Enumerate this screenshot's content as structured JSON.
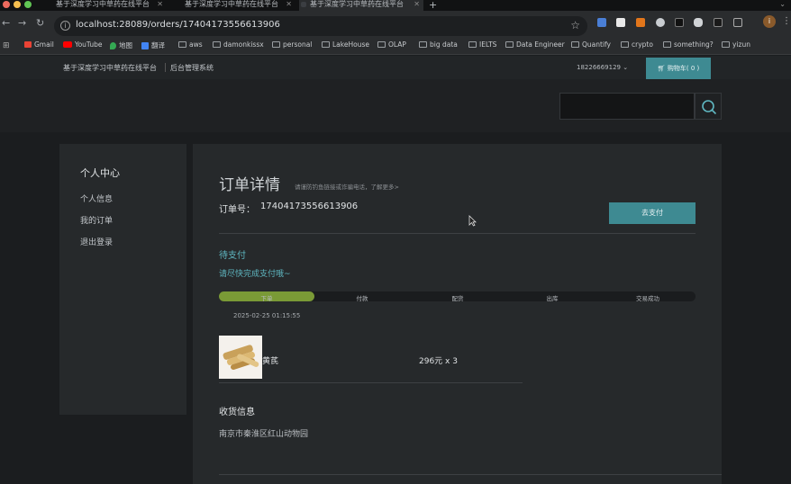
{
  "browser": {
    "tabs": [
      {
        "title": "基于深度学习中草药在线平台",
        "active": false
      },
      {
        "title": "基于深度学习中草药在线平台",
        "active": false
      },
      {
        "title": "基于深度学习中草药在线平台",
        "active": true
      }
    ],
    "url": "localhost:28089/orders/17404173556613906",
    "profile_initial": "i",
    "bookmarks": [
      "Gmail",
      "YouTube",
      "地图",
      "翻译",
      "aws",
      "damonkissx",
      "personal",
      "LakeHouse",
      "OLAP",
      "big data",
      "IELTS",
      "Data Engineer",
      "Quantify",
      "crypto",
      "something?",
      "yizun"
    ]
  },
  "header": {
    "site_title": "基于深度学习中草药在线平台",
    "admin_link": "后台管理系统",
    "user_phone": "18226669129",
    "cart_label": "购物车( 0 )"
  },
  "search": {
    "placeholder": ""
  },
  "sidebar": {
    "title": "个人中心",
    "items": [
      "个人信息",
      "我的订单",
      "退出登录"
    ]
  },
  "order": {
    "title": "订单详情",
    "tip": "请谨防钓鱼链接或诈骗电话，了解更多>",
    "number_label": "订单号：",
    "number": "17404173556613906",
    "pay_button": "去支付",
    "status": "待支付",
    "status_sub": "请尽快完成支付哦~",
    "steps": [
      "下单",
      "付款",
      "配货",
      "出库",
      "交易成功"
    ],
    "progress": 0.2,
    "step_time": "2025-02-25 01:15:55",
    "items": [
      {
        "name": "黄芪",
        "price_qty": "296元 x 3"
      }
    ],
    "receiver_title": "收货信息",
    "receiver_address": "南京市秦淮区红山动物园"
  },
  "colors": {
    "accent": "#3e8a92",
    "status": "#5fb7c1",
    "progress": "#7a9a36"
  }
}
